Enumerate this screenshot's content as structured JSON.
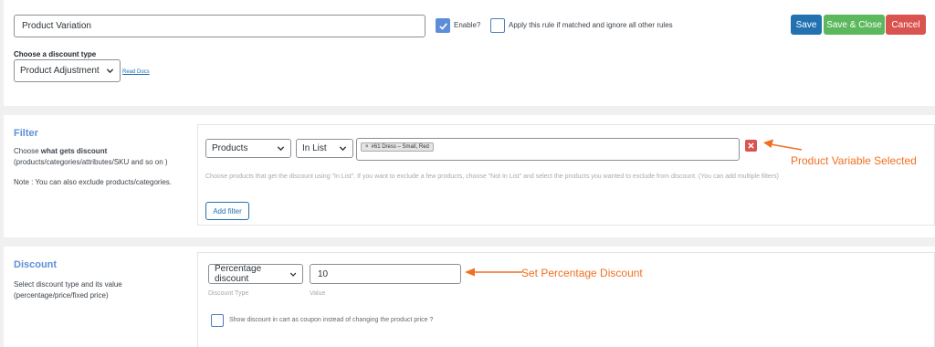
{
  "rule": {
    "title_value": "Product Variation",
    "enable_label": "Enable?",
    "apply_label": "Apply this rule if matched and ignore all other rules",
    "discount_type_heading": "Choose a discount type",
    "discount_type_value": "Product Adjustment",
    "read_docs": "Read Docs"
  },
  "actions": {
    "save": "Save",
    "save_close": "Save & Close",
    "cancel": "Cancel"
  },
  "filter": {
    "title": "Filter",
    "desc_prefix": "Choose ",
    "desc_bold": "what gets discount",
    "desc_suffix": "(products/categories/attributes/SKU and so on )",
    "note": "Note : You can also exclude products/categories.",
    "type_value": "Products",
    "operator_value": "In List",
    "tag_remove": "×",
    "tag_label": "#61 Dress – Small, Red",
    "hint": "Choose products that get the discount using \"In List\". If you want to exclude a few products, choose \"Not In List\" and select the products you wanted to exclude from discount. (You can add multiple filters)",
    "add_filter": "Add filter",
    "annotation": "Product Variable Selected"
  },
  "discount": {
    "title": "Discount",
    "desc": "Select discount type and its value (percentage/price/fixed price)",
    "type_value": "Percentage discount",
    "type_label": "Discount Type",
    "value": "10",
    "value_label": "Value",
    "coupon_label": "Show discount in cart as coupon instead of changing the product price ?",
    "annotation": "Set Percentage Discount"
  },
  "colors": {
    "save": "#2271b1",
    "save_close": "#5cb85c",
    "cancel": "#d9534f",
    "accent_title": "#5d8fd8",
    "annotation": "#f26f21"
  }
}
